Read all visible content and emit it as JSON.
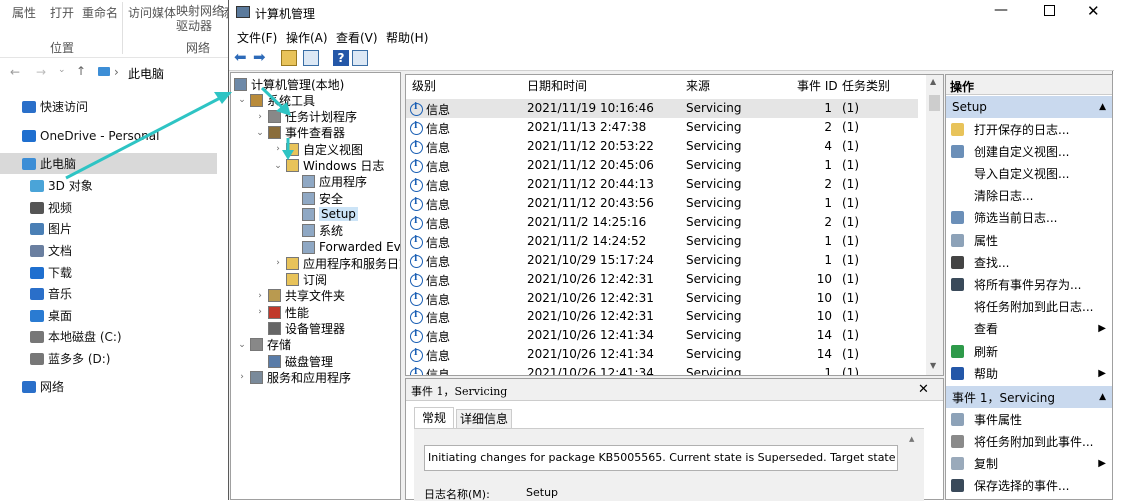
{
  "explorer": {
    "ribbon": {
      "items": [
        "属性",
        "打开",
        "重命名",
        "访问媒体",
        "映射网络\n驱动器",
        "添"
      ],
      "groups": [
        "位置",
        "网络"
      ]
    },
    "address": "此电脑",
    "nav": [
      {
        "label": "快速访问",
        "icon": "star-icon"
      },
      {
        "label": "OneDrive - Personal",
        "icon": "cloud-icon"
      },
      {
        "label": "此电脑",
        "icon": "computer-icon",
        "selected": true
      },
      {
        "label": "3D 对象",
        "icon": "cube-icon"
      },
      {
        "label": "视频",
        "icon": "video-icon"
      },
      {
        "label": "图片",
        "icon": "picture-icon"
      },
      {
        "label": "文档",
        "icon": "document-icon"
      },
      {
        "label": "下载",
        "icon": "download-icon"
      },
      {
        "label": "音乐",
        "icon": "music-icon"
      },
      {
        "label": "桌面",
        "icon": "desktop-icon"
      },
      {
        "label": "本地磁盘 (C:)",
        "icon": "drive-icon"
      },
      {
        "label": "蓝多多 (D:)",
        "icon": "drive-icon"
      },
      {
        "label": "网络",
        "icon": "network-icon"
      }
    ]
  },
  "mmc": {
    "title": "计算机管理",
    "menu": [
      "文件(F)",
      "操作(A)",
      "查看(V)",
      "帮助(H)"
    ],
    "tree": [
      {
        "label": "计算机管理(本地)",
        "level": 0,
        "exp": ""
      },
      {
        "label": "系统工具",
        "level": 1,
        "exp": "v"
      },
      {
        "label": "任务计划程序",
        "level": 2,
        "exp": ">"
      },
      {
        "label": "事件查看器",
        "level": 2,
        "exp": "v"
      },
      {
        "label": "自定义视图",
        "level": 3,
        "exp": ">"
      },
      {
        "label": "Windows 日志",
        "level": 3,
        "exp": "v"
      },
      {
        "label": "应用程序",
        "level": 4,
        "exp": ""
      },
      {
        "label": "安全",
        "level": 4,
        "exp": ""
      },
      {
        "label": "Setup",
        "level": 4,
        "exp": "",
        "selected": true
      },
      {
        "label": "系统",
        "level": 4,
        "exp": ""
      },
      {
        "label": "Forwarded Even",
        "level": 4,
        "exp": ""
      },
      {
        "label": "应用程序和服务日志",
        "level": 3,
        "exp": ">"
      },
      {
        "label": "订阅",
        "level": 3,
        "exp": ""
      },
      {
        "label": "共享文件夹",
        "level": 2,
        "exp": ">"
      },
      {
        "label": "性能",
        "level": 2,
        "exp": ">"
      },
      {
        "label": "设备管理器",
        "level": 2,
        "exp": ""
      },
      {
        "label": "存储",
        "level": 1,
        "exp": "v"
      },
      {
        "label": "磁盘管理",
        "level": 2,
        "exp": ""
      },
      {
        "label": "服务和应用程序",
        "level": 1,
        "exp": ">"
      }
    ],
    "list": {
      "headers": [
        "级别",
        "日期和时间",
        "来源",
        "事件 ID",
        "任务类别"
      ],
      "rows": [
        [
          "信息",
          "2021/11/19 10:16:46",
          "Servicing",
          "1",
          "(1)"
        ],
        [
          "信息",
          "2021/11/13 2:47:38",
          "Servicing",
          "2",
          "(1)"
        ],
        [
          "信息",
          "2021/11/12 20:53:22",
          "Servicing",
          "4",
          "(1)"
        ],
        [
          "信息",
          "2021/11/12 20:45:06",
          "Servicing",
          "1",
          "(1)"
        ],
        [
          "信息",
          "2021/11/12 20:44:13",
          "Servicing",
          "2",
          "(1)"
        ],
        [
          "信息",
          "2021/11/12 20:43:56",
          "Servicing",
          "1",
          "(1)"
        ],
        [
          "信息",
          "2021/11/2 14:25:16",
          "Servicing",
          "2",
          "(1)"
        ],
        [
          "信息",
          "2021/11/2 14:24:52",
          "Servicing",
          "1",
          "(1)"
        ],
        [
          "信息",
          "2021/10/29 15:17:24",
          "Servicing",
          "1",
          "(1)"
        ],
        [
          "信息",
          "2021/10/26 12:42:31",
          "Servicing",
          "10",
          "(1)"
        ],
        [
          "信息",
          "2021/10/26 12:42:31",
          "Servicing",
          "10",
          "(1)"
        ],
        [
          "信息",
          "2021/10/26 12:42:31",
          "Servicing",
          "10",
          "(1)"
        ],
        [
          "信息",
          "2021/10/26 12:41:34",
          "Servicing",
          "14",
          "(1)"
        ],
        [
          "信息",
          "2021/10/26 12:41:34",
          "Servicing",
          "14",
          "(1)"
        ],
        [
          "信息",
          "2021/10/26 12:41:34",
          "Servicing",
          "1",
          "(1)"
        ]
      ]
    },
    "detail": {
      "title": "事件 1，Servicing",
      "tabs": [
        "常规",
        "详细信息"
      ],
      "message": "Initiating changes for package KB5005565. Current state is Superseded. Target state",
      "log_label": "日志名称(M):",
      "log_value": "Setup"
    },
    "actions": {
      "header": "操作",
      "section1": "Setup",
      "items1": [
        {
          "label": "打开保存的日志...",
          "icon": "folder-open-icon"
        },
        {
          "label": "创建自定义视图...",
          "icon": "filter-icon"
        },
        {
          "label": "导入自定义视图...",
          "icon": ""
        },
        {
          "label": "清除日志...",
          "icon": ""
        },
        {
          "label": "筛选当前日志...",
          "icon": "filter-icon"
        },
        {
          "label": "属性",
          "icon": "properties-icon"
        },
        {
          "label": "查找...",
          "icon": "find-icon"
        },
        {
          "label": "将所有事件另存为...",
          "icon": "save-icon"
        },
        {
          "label": "将任务附加到此日志...",
          "icon": ""
        },
        {
          "label": "查看",
          "icon": "",
          "arrow": true
        },
        {
          "label": "刷新",
          "icon": "refresh-icon"
        },
        {
          "label": "帮助",
          "icon": "help-icon",
          "arrow": true
        }
      ],
      "section2": "事件 1，Servicing",
      "items2": [
        {
          "label": "事件属性",
          "icon": "properties-icon"
        },
        {
          "label": "将任务附加到此事件...",
          "icon": "task-icon"
        },
        {
          "label": "复制",
          "icon": "copy-icon",
          "arrow": true
        },
        {
          "label": "保存选择的事件...",
          "icon": "save-icon"
        }
      ]
    }
  },
  "colors": {
    "accent": "#c9d9ee",
    "arrow": "#2ec4c4",
    "info": "#1a5fb4"
  }
}
